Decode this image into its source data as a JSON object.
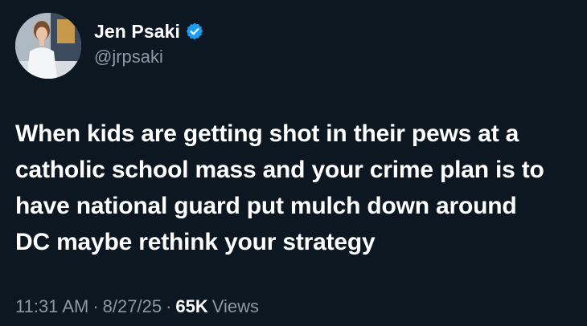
{
  "author": {
    "name": "Jen Psaki",
    "handle": "@jrpsaki",
    "verified_icon": "verified-badge-icon",
    "badge_color": "#1d9bf0"
  },
  "tweet": {
    "text": "When kids are getting shot in their pews at a\ncatholic school mass and your crime plan is to\nhave national guard put mulch down around\nDC maybe rethink your strategy"
  },
  "meta": {
    "time": "11:31 AM",
    "separator": "·",
    "date": "8/27/25",
    "views_count": "65K",
    "views_label": "Views"
  },
  "colors": {
    "background": "#0d1721",
    "text": "#ffffff",
    "muted": "#8b98a5"
  }
}
